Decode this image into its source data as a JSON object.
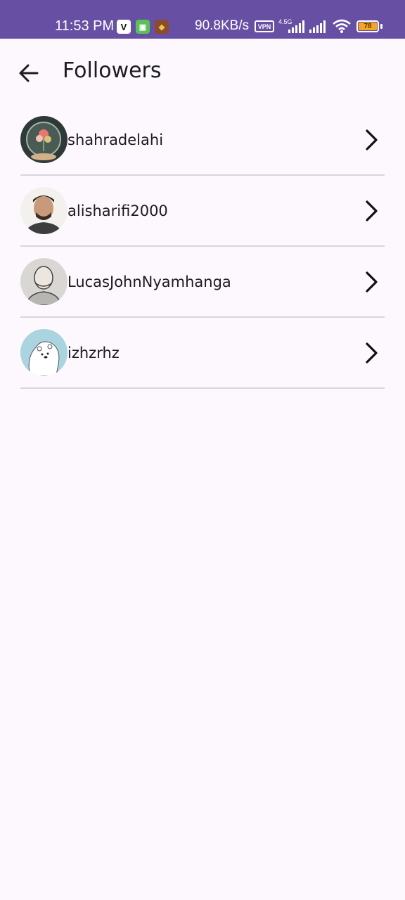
{
  "status_bar": {
    "time": "11:53 PM",
    "net_speed": "90.8KB/s",
    "vpn_label": "VPN",
    "network_type": "4.5G",
    "battery_level": "78",
    "accent_color": "#6750a4",
    "app_icons": [
      "vivo-icon",
      "android-icon",
      "game-icon"
    ]
  },
  "app_bar": {
    "title": "Followers",
    "back_icon": "arrow-left-icon"
  },
  "followers": [
    {
      "username": "shahradelahi",
      "avatar": "avatar-bubble-flowers"
    },
    {
      "username": "alisharifi2000",
      "avatar": "avatar-man-photo"
    },
    {
      "username": "LucasJohnNyamhanga",
      "avatar": "avatar-sketch-man"
    },
    {
      "username": "izhzrhz",
      "avatar": "avatar-polar-bear"
    }
  ],
  "row_action_icon": "chevron-right-icon"
}
